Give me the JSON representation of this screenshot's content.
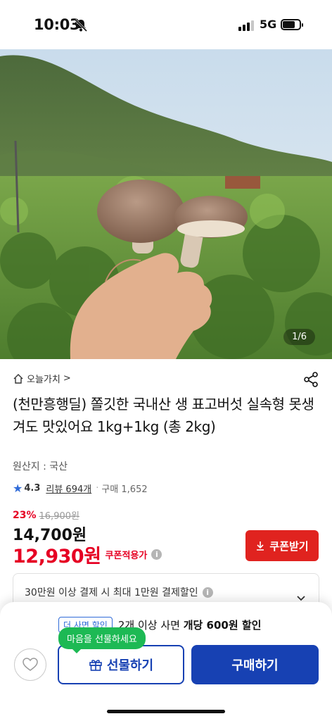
{
  "status_bar": {
    "time": "10:03",
    "network": "5G",
    "icons": [
      "bell-off-icon",
      "signal-icon",
      "battery-icon"
    ]
  },
  "hero": {
    "image_counter": "1/6",
    "description_icon": "mushroom-photo"
  },
  "product": {
    "brand": "오늘가치",
    "brand_chevron": ">",
    "title": "(천만흥행딜) 쫄깃한 국내산 생 표고버섯 실속형 못생겨도 맛있어요 1kg+1kg (총 2kg)",
    "origin": "원산지 : 국산",
    "rating": "4.3",
    "reviews": "리뷰 694개",
    "separator": "·",
    "purchases": "구매 1,652"
  },
  "pricing": {
    "discount_rate": "23%",
    "original_price": "16,900원",
    "price": "14,700원",
    "coupon_price": "12,930원",
    "coupon_label": "쿠폰적용가",
    "coupon_button": "쿠폰받기"
  },
  "payment_benefit": {
    "text": "30만원 이상 결제 시 최대 1만원 결제할인"
  },
  "bottom_sheet": {
    "promo_badge": "더 사면 할인",
    "promo_prefix": "2개 이상 사면",
    "promo_bold": "개당 600원 할인",
    "tooltip": "마음을 선물하세요",
    "gift_button": "선물하기",
    "buy_button": "구매하기"
  },
  "colors": {
    "accent_red": "#e0231f",
    "accent_blue": "#1741b3",
    "rating_blue": "#2f6bd8",
    "tooltip_green": "#1db954"
  }
}
